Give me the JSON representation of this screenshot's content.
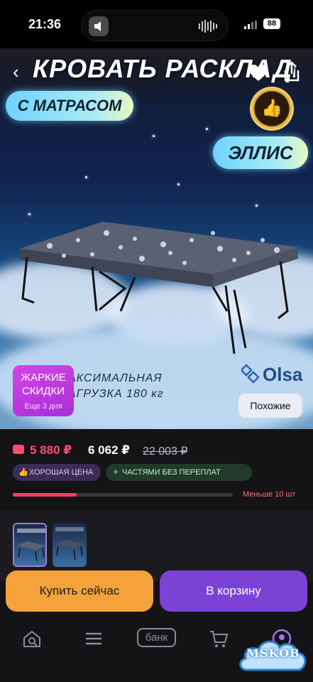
{
  "status_bar": {
    "time": "21:36",
    "battery": "88"
  },
  "hero": {
    "title": "КРОВАТЬ РАСКЛАДНАЯ",
    "subtitle_pill": "С МАТРАСОМ",
    "model_pill": "ЭЛЛИС",
    "load_line1": "АКСИМАЛЬНАЯ",
    "load_line2": "АГРУЗКА 180 кг",
    "brand": "Olsa",
    "promo_title_line1": "ЖАРКИЕ",
    "promo_title_line2": "СКИДКИ",
    "promo_sub": "Еще 3 дня",
    "similar_label": "Похожие"
  },
  "price": {
    "main": "5 880 ₽",
    "secondary": "6 062 ₽",
    "old": "22 003 ₽",
    "main_color": "#ff4f73"
  },
  "tags": [
    {
      "label": "ХОРОШАЯ ЦЕНА",
      "icon": "thumbs-up-icon"
    },
    {
      "label": "ЧАСТЯМИ БЕЗ ПЕРЕПЛАТ",
      "icon": "plus-icon"
    }
  ],
  "stock": {
    "label": "Меньше 10 шт",
    "fill_fraction": 0.29
  },
  "buttons": {
    "buy_now": "Купить сейчас",
    "add_to_cart": "В корзину"
  },
  "tab_bar": {
    "items": [
      "home-search-icon",
      "menu-icon",
      "bank",
      "cart-icon",
      "profile-icon"
    ],
    "bank_label": "банк"
  },
  "watermark": "MSKOB",
  "colors": {
    "buy": "#f3a23c",
    "cart": "#7a43d6",
    "promo": "#c93be2"
  }
}
